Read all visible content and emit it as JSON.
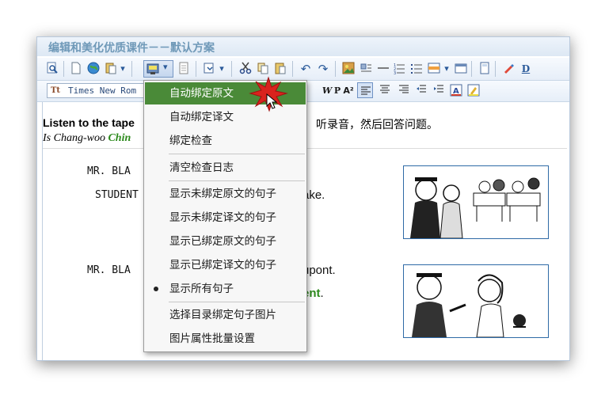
{
  "window": {
    "title": "编辑和美化优质课件－－默认方案"
  },
  "toolbar_font": {
    "name": "Times New Rom",
    "icon": "font-icon"
  },
  "content": {
    "heading": "Listen to the tape",
    "heading_cn": "听录音，然后回答问题。",
    "sub_prefix": "Is Chang-woo ",
    "sub_green": "Chin",
    "line1": "MR. BLA",
    "line2": "STUDENT",
    "line2_tail": "ake.",
    "line3": "MR. BLA",
    "line3_tail": "upont.",
    "line4_tail_green": "ent",
    "line4_dot": "."
  },
  "menu": {
    "items": [
      {
        "label": "自动绑定原文",
        "highlighted": true
      },
      {
        "label": "自动绑定译文"
      },
      {
        "label": "绑定检查"
      },
      {
        "label": "清空检查日志"
      },
      {
        "label": "显示未绑定原文的句子"
      },
      {
        "label": "显示未绑定译文的句子"
      },
      {
        "label": "显示已绑定原文的句子"
      },
      {
        "label": "显示已绑定译文的句子"
      },
      {
        "label": "显示所有句子",
        "checked": true
      },
      {
        "label": "选择目录绑定句子图片"
      },
      {
        "label": "图片属性批量设置"
      }
    ]
  },
  "colors": {
    "menu_highlight": "#4a8a38",
    "title": "#6f99b8",
    "green_text": "#2c8a1c",
    "frame": "#2e6aa6"
  }
}
